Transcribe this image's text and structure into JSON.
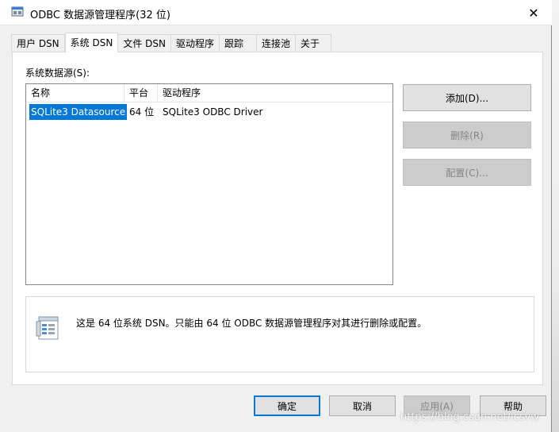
{
  "window": {
    "title": "ODBC 数据源管理程序(32 位)",
    "close_glyph": "✕"
  },
  "tabs": [
    {
      "label": "用户 DSN",
      "active": false
    },
    {
      "label": "系统 DSN",
      "active": true
    },
    {
      "label": "文件 DSN",
      "active": false
    },
    {
      "label": "驱动程序",
      "active": false
    },
    {
      "label": "跟踪",
      "active": false
    },
    {
      "label": "连接池",
      "active": false
    },
    {
      "label": "关于",
      "active": false
    }
  ],
  "panel": {
    "section_label": "系统数据源(S):",
    "columns": [
      "名称",
      "平台",
      "驱动程序"
    ],
    "rows": [
      {
        "name": "SQLite3 Datasource",
        "platform": "64 位",
        "driver": "SQLite3 ODBC Driver",
        "selected": true
      }
    ],
    "buttons": {
      "add": "添加(D)...",
      "remove": "删除(R)",
      "configure": "配置(C)..."
    },
    "info_text": "这是 64 位系统 DSN。只能由 64 位 ODBC 数据源管理程序对其进行删除或配置。"
  },
  "footer": {
    "ok": "确定",
    "cancel": "取消",
    "apply": "应用(A)",
    "help": "帮助"
  },
  "watermark": "https://blog.csdn.net/lcsvw",
  "colors": {
    "accent": "#0078d7",
    "window_bg": "#f0f0f0",
    "button_bg": "#e1e1e1",
    "disabled_text": "#838383"
  }
}
